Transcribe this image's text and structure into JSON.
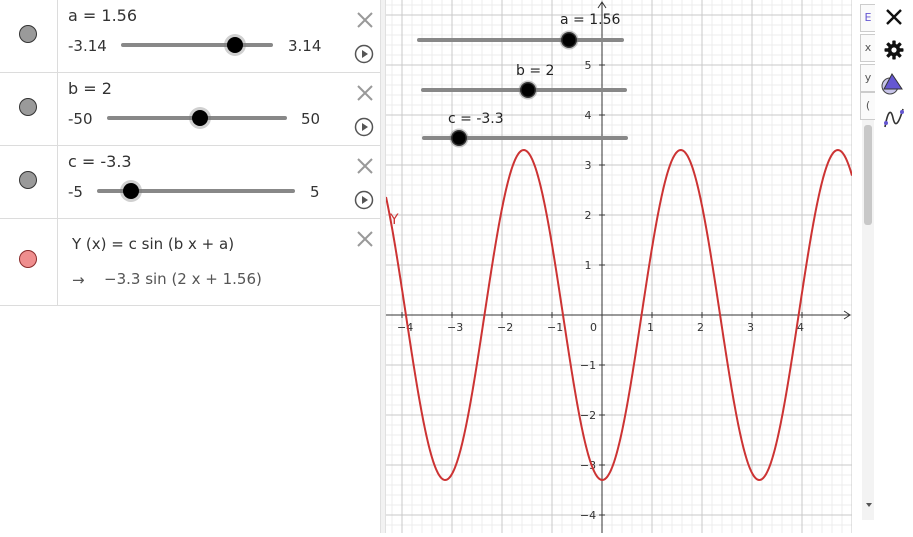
{
  "sliders": [
    {
      "label": "a = 1.56",
      "min_label": "-3.14",
      "max_label": "3.14",
      "min": -3.14,
      "max": 3.14,
      "value": 1.56
    },
    {
      "label": "b = 2",
      "min_label": "-50",
      "max_label": "50",
      "min": -50,
      "max": 50,
      "value": 2
    },
    {
      "label": "c = -3.3",
      "min_label": "-5",
      "max_label": "5",
      "min": -5,
      "max": 5,
      "value": -3.3
    }
  ],
  "function": {
    "definition": "Y (x) = c  sin (b x + a)",
    "arrow": "→",
    "result": "−3.3  sin (2 x + 1.56)",
    "curve_label": "Y",
    "color": "#cc3333"
  },
  "graph_sliders": [
    {
      "label": "a = 1.56"
    },
    {
      "label": "b = 2"
    },
    {
      "label": "c = -3.3"
    }
  ],
  "axes": {
    "x_ticks": [
      "−4",
      "−3",
      "−2",
      "−1",
      "0",
      "1",
      "2",
      "3",
      "4"
    ],
    "y_ticks": [
      "5",
      "4",
      "3",
      "2",
      "1",
      "−1",
      "−2",
      "−3",
      "−4"
    ],
    "x_range": [
      -4.3,
      5.0
    ],
    "y_range": [
      -4.3,
      6.4
    ]
  },
  "right_tabs": [
    "E",
    "x",
    "y",
    "("
  ],
  "icons": {
    "close": "close-icon",
    "settings": "gear-icon",
    "shapes": "shapes-tool-icon",
    "curve": "function-tool-icon",
    "scroll_down": "scroll-down-icon"
  },
  "colors": {
    "accent": "#6557d2",
    "curve": "#cc3333"
  }
}
